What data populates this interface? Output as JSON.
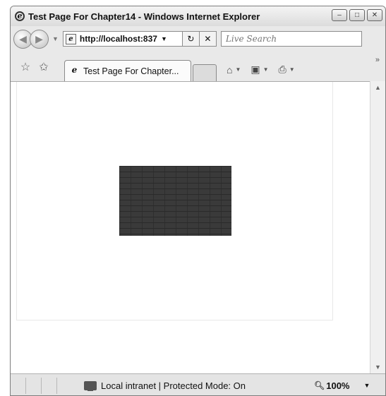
{
  "window": {
    "title": "Test Page For Chapter14 - Windows Internet Explorer",
    "controls": {
      "minimize": "–",
      "maximize": "□",
      "close": "✕"
    }
  },
  "nav": {
    "back_icon": "back-arrow-icon",
    "forward_icon": "forward-arrow-icon",
    "address": "http://localhost:837",
    "search_placeholder": "Live Search"
  },
  "tabs": [
    {
      "label": "Test Page For Chapter...",
      "active": true
    }
  ],
  "status": {
    "zone": "Local intranet | Protected Mode: On",
    "zoom": "100%"
  },
  "content": {
    "image": "brick-texture"
  },
  "colors": {
    "chrome": "#e9e9e9",
    "brick": "#3a3a3a"
  }
}
